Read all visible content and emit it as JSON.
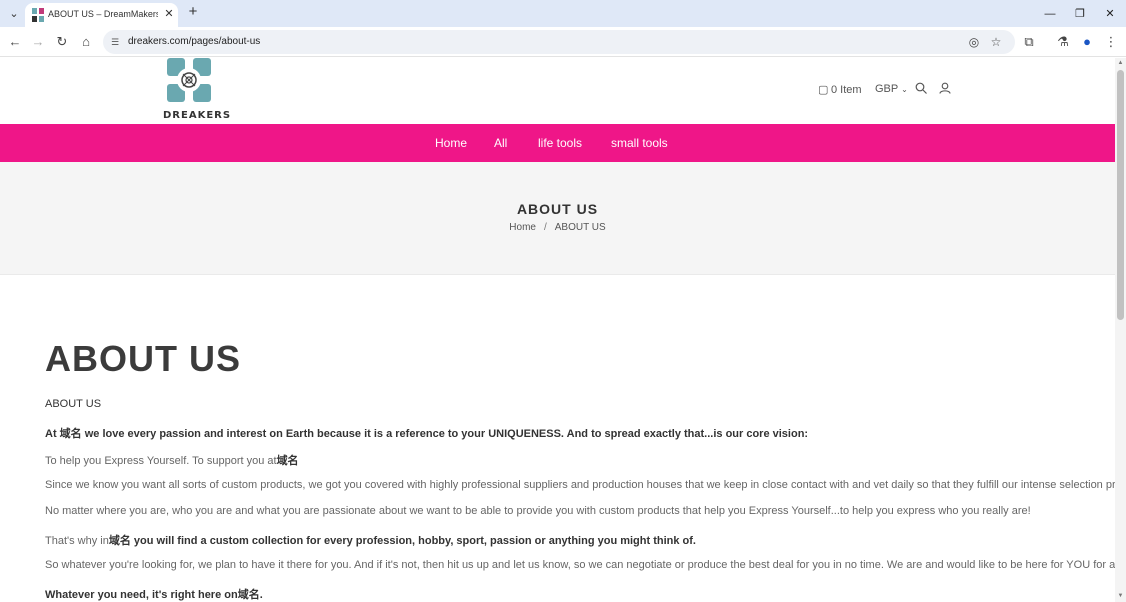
{
  "browser": {
    "tab_title": "ABOUT US – DreamMakers Sta",
    "url": "dreakers.com/pages/about-us"
  },
  "header": {
    "logo_text": "DREAKERS",
    "cart_label": "0 Item",
    "currency": "GBP"
  },
  "nav": {
    "items": [
      "Home",
      "All",
      "life tools",
      "small tools"
    ]
  },
  "banner": {
    "title": "ABOUT US",
    "breadcrumb_home": "Home",
    "breadcrumb_sep": "/",
    "breadcrumb_current": "ABOUT US"
  },
  "content": {
    "heading": "ABOUT US",
    "sub_heading": "ABOUT US",
    "p1": "At 域名 we love every passion and interest on Earth because it is a reference to your UNIQUENESS. And to spread exactly that...is our core vision:",
    "p2_text": "To help you Express Yourself. To support you at",
    "p2_bold": "域名",
    "p3": "Since we know you want all sorts of custom products, we got you covered with highly professional suppliers and production houses that we keep in close contact with and vet daily so that they fulfill our intense selection process.",
    "p4": "No matter where you are, who you are and what you are passionate about we want to be able to provide you with custom products that help you Express Yourself...to help you express who you really are!",
    "p5_text": "That's why in",
    "p5_bold": "域名 you will find a custom collection for every profession, hobby, sport, passion or anything you might think of.",
    "p6": "So whatever you're looking for, we plan to have it there for you. And if it's not, then hit us up and let us know, so we can negotiate or produce the best deal for you in no time. We are and would like to be here for YOU for a lifetime.",
    "p7": "Whatever you need, it's right here on域名."
  },
  "colors": {
    "nav_bg": "#ef1688",
    "logo_teal": "#6aa8b0"
  }
}
